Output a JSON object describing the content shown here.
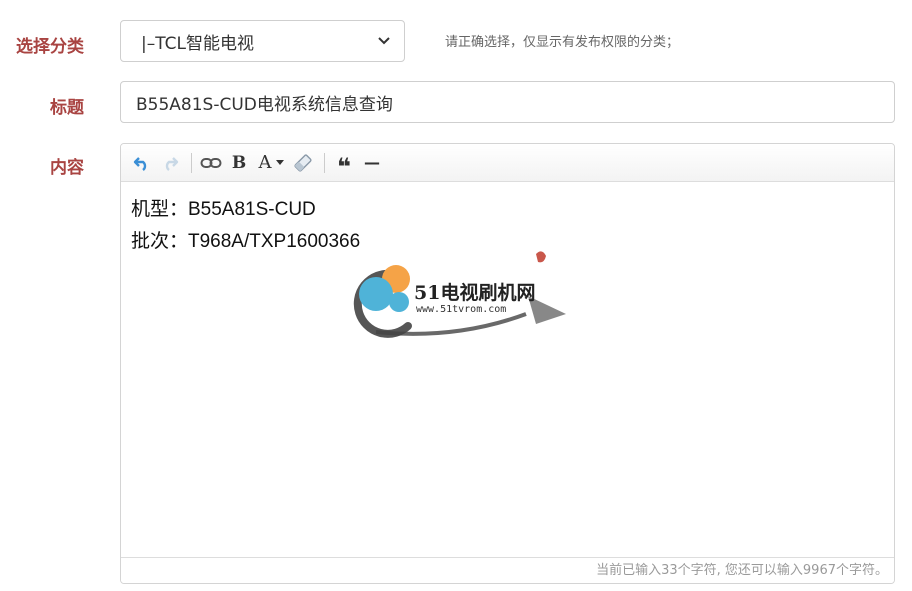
{
  "category": {
    "label": "选择分类",
    "selected": "|–TCL智能电视",
    "help": "请正确选择，仅显示有发布权限的分类；"
  },
  "title_field": {
    "label": "标题",
    "value": "B55A81S-CUD电视系统信息查询"
  },
  "content_field": {
    "label": "内容",
    "toolbar": [
      "undo-icon",
      "redo-icon",
      "link-icon",
      "bold-icon",
      "font-color-icon",
      "eraser-icon",
      "quote-icon",
      "horizontal-rule-icon"
    ],
    "bold_glyph": "B",
    "font_glyph": "A",
    "quote_glyph": "❝",
    "hr_glyph": "—",
    "lines": [
      "机型：B55A81S-CUD",
      "批次：T968A/TXP1600366"
    ],
    "watermark": {
      "title": "51电视刷机网",
      "url": "www.51tvrom.com"
    },
    "counter": "当前已输入33个字符, 您还可以输入9967个字符。"
  }
}
